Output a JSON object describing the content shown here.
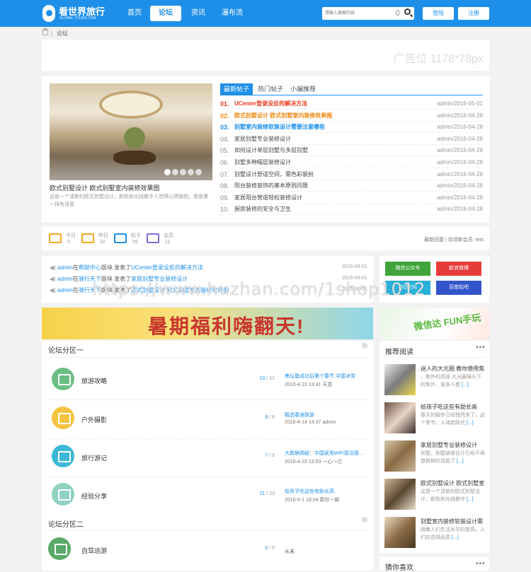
{
  "header": {
    "brand": "看世界旅行",
    "brand_sub": "GLOBAL TOURS.COM",
    "nav": [
      "首页",
      "论坛",
      "资讯",
      "瀑布流"
    ],
    "search_placeholder": "请输入搜索内容",
    "login": "登陆",
    "register": "注册"
  },
  "breadcrumb": {
    "sep": "|",
    "current": "论坛"
  },
  "ad": {
    "text": "广告位 1178*78px"
  },
  "feature": {
    "caption": "欧式别墅设计 欧式别墅室内装修效果图",
    "desc": "这是一个清新的欧式别墅设计，颜色和光线都令人觉得心情愉悦。我是第一排有诗意",
    "tabs": [
      "最新帖子",
      "热门帖子",
      "小编推荐"
    ],
    "rows": [
      {
        "n": "01.",
        "t": "UCenter登录没反的解决方法",
        "m": "admin/2016-05-01",
        "c": "#e8381b"
      },
      {
        "n": "02.",
        "t": "欧式别墅设计 欧式别墅室内装修效果图",
        "m": "admin/2016-04-28",
        "c": "#f08a16"
      },
      {
        "n": "03.",
        "t": "别墅室内装修软装设计需要注意哪些",
        "m": "admin/2016-04-28",
        "c": "#1e8fe8"
      },
      {
        "n": "04.",
        "t": "家居别墅专业装修设计",
        "m": "admin/2016-04-28"
      },
      {
        "n": "05.",
        "t": "如何设计单层别墅与多层别墅",
        "m": "admin/2016-04-28"
      },
      {
        "n": "06.",
        "t": "别墅多种幅层装修设计",
        "m": "admin/2016-04-28"
      },
      {
        "n": "07.",
        "t": "别墅设计舒适空间，需色彩装扮",
        "m": "admin/2016-04-28"
      },
      {
        "n": "08.",
        "t": "阳台装修装饰的基本原则问题",
        "m": "admin/2016-04-28"
      },
      {
        "n": "09.",
        "t": "家居阳台营造轻松装修设计",
        "m": "admin/2016-04-28"
      },
      {
        "n": "10.",
        "t": "厨房装修的安全与卫生",
        "m": "admin/2016-04-28"
      }
    ]
  },
  "stats": {
    "items": [
      {
        "label": "今日",
        "value": "0"
      },
      {
        "label": "昨日",
        "value": "32"
      },
      {
        "label": "帖子",
        "value": "99"
      },
      {
        "label": "会员",
        "value": "11"
      }
    ],
    "right": "最新回复 | 欢迎新会员: test"
  },
  "news": [
    {
      "user": "admin",
      "pre": "在",
      "board": "帮助中心",
      "mid": "版块 发表了",
      "title": "UCenter登录没反的解决方法",
      "date": "2015-09-01"
    },
    {
      "user": "admin",
      "pre": "在",
      "board": "骑行天下",
      "mid": "版块 发表了",
      "title": "家居别墅专业装修设计",
      "date": "2015-09-01"
    },
    {
      "user": "admin",
      "pre": "在",
      "board": "骑行天下",
      "mid": "版块 发表了",
      "title": "欧式别墅设计 欧式别墅室内装修效果图",
      "date": "2015-09-01"
    }
  ],
  "share": [
    "微信公众号",
    "新浪微博",
    "QQ空间",
    "百度贴吧"
  ],
  "watermark": "https://www.huzhan.com/1shop1012",
  "banner": {
    "main": "暑期福利嗨翻天!",
    "side": "微信达 FUN手玩"
  },
  "forum": {
    "section1": "论坛分区一",
    "section2": "论坛分区二",
    "boards": [
      {
        "name": "旅游攻略",
        "today": "10",
        "total": "12",
        "last": "串坛基成功后第个春节 中国冰雪",
        "meta": "2016-4-23 13:41 天意",
        "color": "#6cbf84"
      },
      {
        "name": "户外摄影",
        "today": "8",
        "total": "8",
        "last": "精选春骑探游",
        "meta": "2016-4-14 14:37 admin",
        "color": "#f4c33f"
      },
      {
        "name": "旅行游记",
        "today": "7",
        "total": "9",
        "last": "大数据揭秘：中国家用WiFi现况密...",
        "meta": "2016-4-23 13:53 一心一亿",
        "color": "#3db8d6"
      },
      {
        "name": "经验分享",
        "today": "21",
        "total": "23",
        "last": "给孩子吃这些有助长高",
        "meta": "2016-5-1 18:04 算你一脚",
        "color": "#8fd2c0"
      },
      {
        "name": "自驾远游",
        "today": "0",
        "total": "0",
        "last": "从未",
        "meta": "",
        "color": "#5aa96a"
      }
    ]
  },
  "recommend": {
    "title": "推荐阅读",
    "more": "•••",
    "items": [
      {
        "title": "迷人的大光圈 教你使用焦",
        "desc": "，焦外的用途 大光圈镜头下的焦外，很多人都",
        "link": "[...]"
      },
      {
        "title": "给孩子吃这些有助长高",
        "desc": "春天的脚步已经悄然来了，这个季节，人体新陈代",
        "link": "[...]"
      },
      {
        "title": "家居别墅专业装修设计",
        "desc": "别墅，别墅装修设计已经不再是新鲜的话题了",
        "link": "[...]"
      },
      {
        "title": "欧式别墅设计 欧式别墅室",
        "desc": "这是一个清新的欧式别墅设计，颜色和光线都令",
        "link": "[...]"
      },
      {
        "title": "别墅室内装修软装设计需",
        "desc": "随着人们生活水平的提高，人们在选择品质",
        "link": "[...]"
      }
    ],
    "guess": "猜你喜欢"
  }
}
